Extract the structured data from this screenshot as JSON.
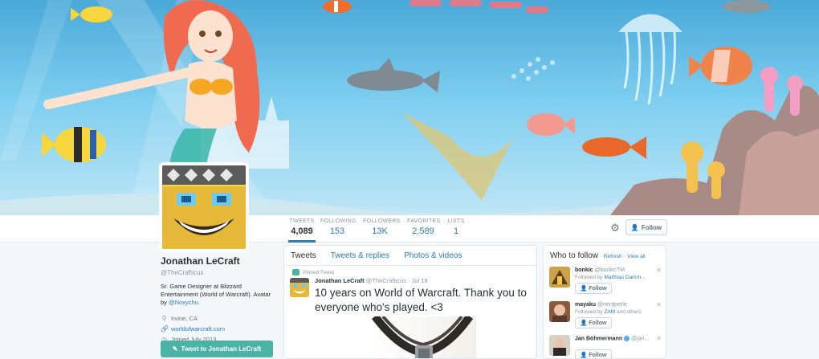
{
  "banner": {
    "description_icon": "underwater-mermaid-banner"
  },
  "stats": [
    {
      "label": "TWEETS",
      "value": "4,089"
    },
    {
      "label": "FOLLOWING",
      "value": "153"
    },
    {
      "label": "FOLLOWERS",
      "value": "13K"
    },
    {
      "label": "FAVORITES",
      "value": "2,589"
    },
    {
      "label": "LISTS",
      "value": "1"
    }
  ],
  "actions": {
    "follow_label": "Follow",
    "gear_icon": "gear-icon"
  },
  "profile": {
    "name": "Jonathan LeCraft",
    "handle": "@TheCrafticus",
    "bio_text": "Sr. Game Designer at Blizzard Entertainment (World of Warcraft). Avatar by",
    "bio_link": "@Noxychu",
    "bio_end": ".",
    "location": "Irvine, CA",
    "website": "worldofwarcraft.com",
    "joined": "Joined July 2013",
    "tweet_to": "Tweet to Jonathan LeCraft"
  },
  "timeline": {
    "tabs": [
      "Tweets",
      "Tweets & replies",
      "Photos & videos"
    ],
    "pinned_label": "Pinned Tweet",
    "tweet": {
      "author": "Jonathan LeCraft",
      "handle": "@TheCrafticus",
      "date": "· Jul 18",
      "text": "10 years on World of Warcraft.  Thank you to everyone who's played. <3"
    }
  },
  "who_to_follow": {
    "title": "Who to follow",
    "refresh": "· Refresh",
    "view_all": "· View all",
    "follow_label": "Follow",
    "items": [
      {
        "name": "bonkic",
        "handle": "@bonkicTM",
        "by_prefix": "Followed by",
        "by_link": "Matthias Damm...",
        "by_suffix": ""
      },
      {
        "name": "mayaku",
        "handle": "@nerdperle",
        "by_prefix": "Followed by",
        "by_link": "ZAM",
        "by_suffix": " and others"
      },
      {
        "name": "Jan Böhmermann",
        "handle": "@jan...",
        "by_prefix": "",
        "by_link": "",
        "by_suffix": ""
      }
    ]
  },
  "colors": {
    "accent": "#2b7bb9",
    "tweet_to_button": "#4ab3a6",
    "ocean": "#4aa9d8"
  }
}
